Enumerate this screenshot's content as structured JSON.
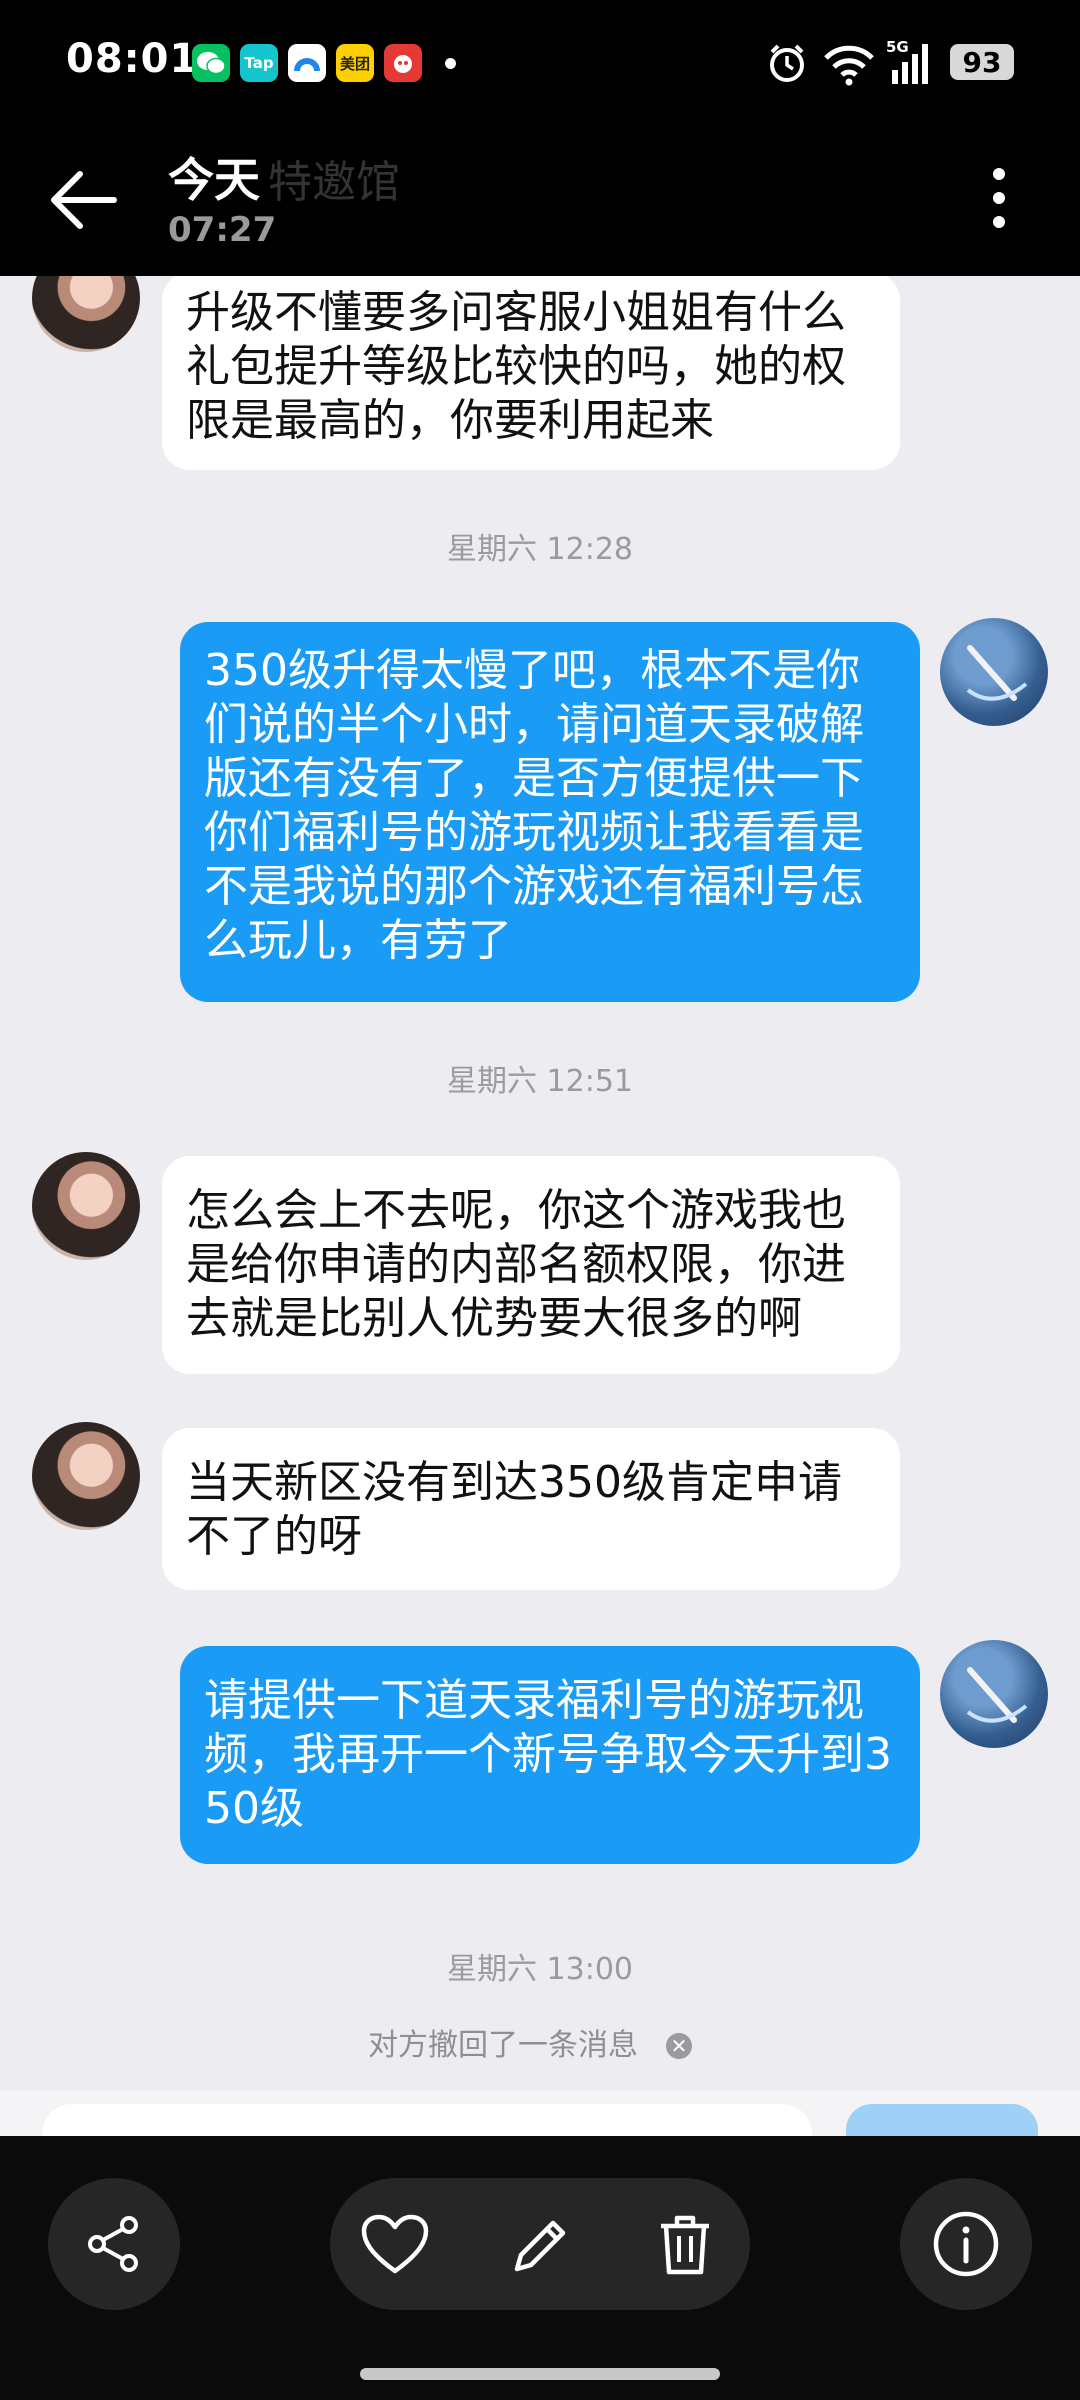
{
  "status_bar": {
    "time": "08:01",
    "battery": "93",
    "app_icons": [
      "wechat",
      "taptap",
      "browser",
      "meituan",
      "game"
    ],
    "signal": "5G",
    "tap_label": "Tap",
    "meituan_label": "美团"
  },
  "header": {
    "title": "今天",
    "subtitle": "07:27",
    "ghost_title": "特邀馆"
  },
  "messages": [
    {
      "side": "in",
      "text": "升级不懂要多问客服小姐姐有什么礼包提升等级比较快的吗，她的权限是最高的，你要利用起来"
    },
    {
      "side": "out",
      "text": "350级升得太慢了吧，根本不是你们说的半个小时，请问道天录破解版还有没有了，是否方便提供一下你们福利号的游玩视频让我看看是不是我说的那个游戏还有福利号怎么玩儿，有劳了"
    },
    {
      "side": "in",
      "text": "怎么会上不去呢，你这个游戏我也是给你申请的内部名额权限，你进去就是比别人优势要大很多的啊"
    },
    {
      "side": "in",
      "text": "当天新区没有到达350级肯定申请不了的呀"
    },
    {
      "side": "out",
      "text": "请提供一下道天录福利号的游玩视频，我再开一个新号争取今天升到350级"
    }
  ],
  "time_separators": [
    "星期六 12:28",
    "星期六 12:51",
    "星期六 13:00"
  ],
  "recall_notice": "对方撤回了一条消息",
  "bottom_actions": [
    "share",
    "favorite",
    "edit",
    "delete",
    "info"
  ],
  "colors": {
    "outgoing_bubble": "#1a9bf6",
    "incoming_bubble": "#ffffff",
    "chat_background": "#ececf1",
    "bar_background": "#000000"
  }
}
